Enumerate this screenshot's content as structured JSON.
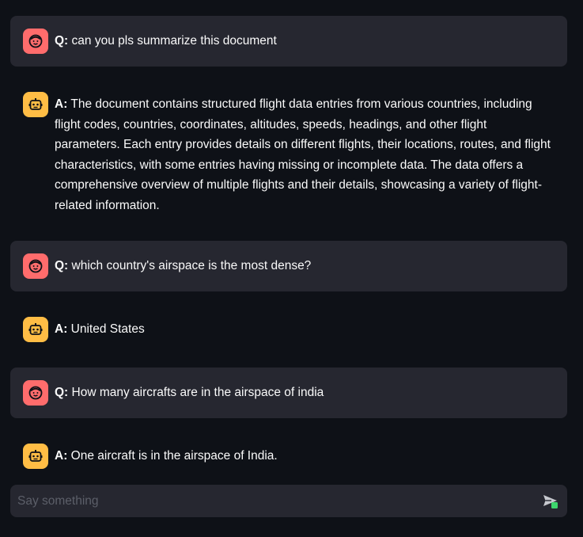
{
  "messages": [
    {
      "role": "user",
      "prefix": "Q:",
      "text": "can you pls summarize this document"
    },
    {
      "role": "assistant",
      "prefix": "A:",
      "text": "The document contains structured flight data entries from various countries, including flight codes, countries, coordinates, altitudes, speeds, headings, and other flight parameters. Each entry provides details on different flights, their locations, routes, and flight characteristics, with some entries having missing or incomplete data. The data offers a comprehensive overview of multiple flights and their details, showcasing a variety of flight-related information."
    },
    {
      "role": "user",
      "prefix": "Q:",
      "text": "which country's airspace is the most dense?"
    },
    {
      "role": "assistant",
      "prefix": "A:",
      "text": "United States"
    },
    {
      "role": "user",
      "prefix": "Q:",
      "text": "How many aircrafts are in the airspace of india"
    },
    {
      "role": "assistant",
      "prefix": "A:",
      "text": "One aircraft is in the airspace of India."
    }
  ],
  "chat_input": {
    "placeholder": "Say something",
    "value": ""
  },
  "icons": {
    "user_avatar": "smiley-face-icon",
    "assistant_avatar": "robot-icon",
    "send": "send-icon"
  },
  "colors": {
    "background": "#0e1117",
    "user_message_bg": "#262730",
    "user_avatar": "#ff6c6c",
    "assistant_avatar": "#ffbd45",
    "send_accent": "#3dd56d"
  }
}
